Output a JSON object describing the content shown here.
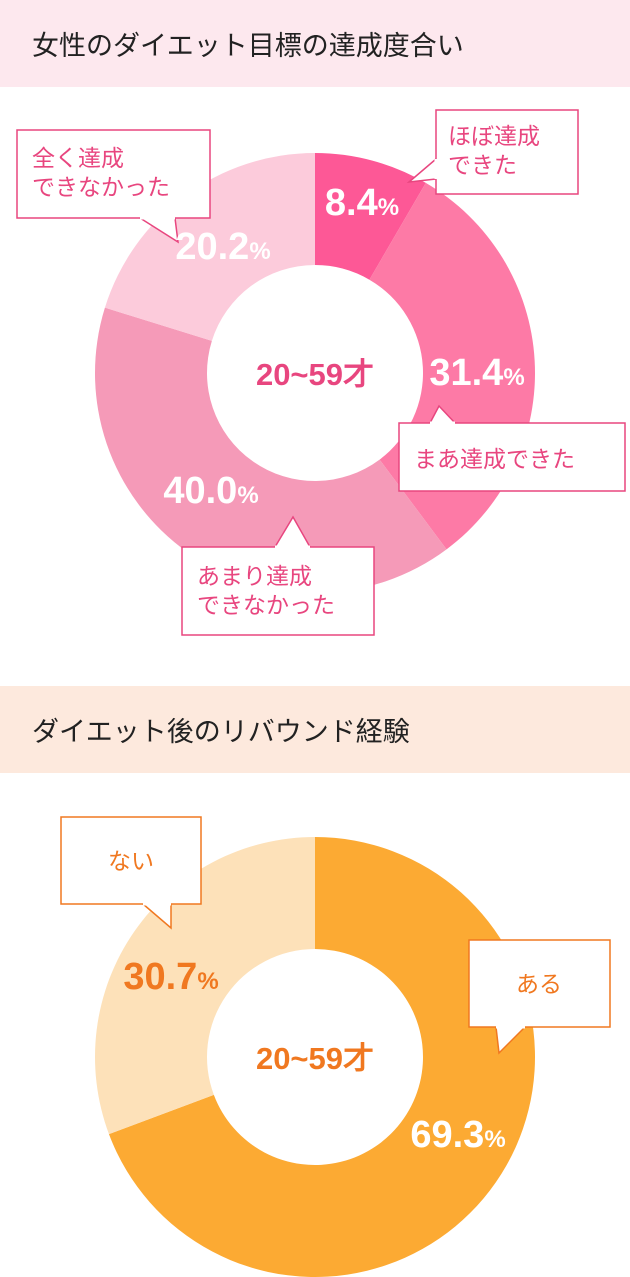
{
  "chart_data": [
    {
      "type": "pie",
      "title": "女性のダイエット目標の達成度合い",
      "center_label": "20~59才",
      "slices": [
        {
          "label": "ほぼ達成できた",
          "label_lines": [
            "ほぼ達成",
            "できた"
          ],
          "value": 8.4,
          "value_text": "8.4",
          "unit": "%",
          "color": "#fd5896"
        },
        {
          "label": "まあ達成できた",
          "label_lines": [
            "まあ達成できた"
          ],
          "value": 31.4,
          "value_text": "31.4",
          "unit": "%",
          "color": "#fd7aa6"
        },
        {
          "label": "あまり達成できなかった",
          "label_lines": [
            "あまり達成",
            "できなかった"
          ],
          "value": 40.0,
          "value_text": "40.0",
          "unit": "%",
          "color": "#f59ab8"
        },
        {
          "label": "全く達成できなかった",
          "label_lines": [
            "全く達成",
            "できなかった"
          ],
          "value": 20.2,
          "value_text": "20.2",
          "unit": "%",
          "color": "#fccbdb"
        }
      ],
      "accent_color": "#e8467f"
    },
    {
      "type": "pie",
      "title": "ダイエット後のリバウンド経験",
      "center_label": "20~59才",
      "slices": [
        {
          "label": "ある",
          "label_lines": [
            "ある"
          ],
          "value": 69.3,
          "value_text": "69.3",
          "unit": "%",
          "color": "#fcaa33"
        },
        {
          "label": "ない",
          "label_lines": [
            "ない"
          ],
          "value": 30.7,
          "value_text": "30.7",
          "unit": "%",
          "color": "#fde1b9"
        }
      ],
      "accent_color": "#f07820"
    }
  ]
}
